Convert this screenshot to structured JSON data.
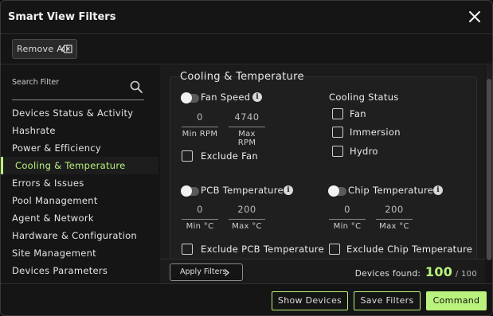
{
  "header": {
    "title": "Smart View Filters"
  },
  "toolbar": {
    "remove_all": "Remove All"
  },
  "sidebar": {
    "search_label": "Search Filter",
    "items": [
      {
        "label": "Devices Status & Activity"
      },
      {
        "label": "Hashrate"
      },
      {
        "label": "Power & Efficiency"
      },
      {
        "label": "Cooling & Temperature"
      },
      {
        "label": "Errors & Issues"
      },
      {
        "label": "Pool Management"
      },
      {
        "label": "Agent & Network"
      },
      {
        "label": "Hardware & Configuration"
      },
      {
        "label": "Site Management"
      },
      {
        "label": "Devices Parameters"
      }
    ],
    "active_index": 3
  },
  "section": {
    "title": "Cooling & Temperature",
    "fan_speed": {
      "label": "Fan Speed",
      "min_value": "0",
      "max_value": "4740",
      "min_label": "Min RPM",
      "max_label": "Max RPM",
      "exclude_label": "Exclude Fan"
    },
    "cooling_status": {
      "label": "Cooling Status",
      "options": [
        {
          "label": "Fan"
        },
        {
          "label": "Immersion"
        },
        {
          "label": "Hydro"
        }
      ]
    },
    "pcb_temp": {
      "label": "PCB Temperature",
      "min_value": "0",
      "max_value": "200",
      "min_label": "Min °C",
      "max_label": "Max °C",
      "exclude_label": "Exclude PCB Temperature"
    },
    "chip_temp": {
      "label": "Chip Temperature",
      "min_value": "0",
      "max_value": "200",
      "min_label": "Min °C",
      "max_label": "Max °C",
      "exclude_label": "Exclude Chip Temperature"
    }
  },
  "footer": {
    "apply_label": "Apply Filters",
    "devices_found_label": "Devices found:",
    "devices_found_count": "100",
    "devices_total": "/ 100"
  },
  "actions": {
    "show_devices": "Show Devices",
    "save_filters": "Save Filters",
    "command": "Command"
  },
  "colors": {
    "accent": "#b9f27c",
    "background": "#151515"
  }
}
